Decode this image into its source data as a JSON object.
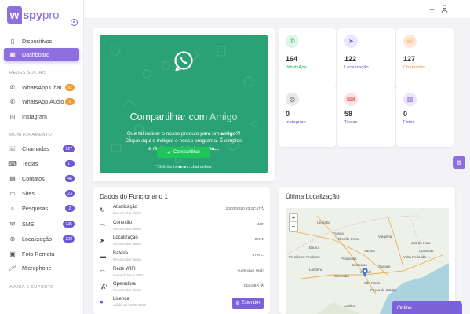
{
  "brand": {
    "mark": "w",
    "name_bold": "spy",
    "name_light": "pro"
  },
  "sidebar": {
    "top_items": [
      {
        "label": "Dispositivos",
        "icon": "phone-icon"
      },
      {
        "label": "Dashboard",
        "icon": "dashboard-icon"
      }
    ],
    "sections": {
      "social": "REDES SOCIAIS",
      "monitor": "MONITORAMENTO",
      "help": "AJUDA E SUPORTE"
    },
    "social_items": [
      {
        "label": "WhatsApp Chat",
        "icon": "whatsapp-icon",
        "badge": "92"
      },
      {
        "label": "WhatsApp Áudio",
        "icon": "whatsapp-audio-icon",
        "badge": "0"
      },
      {
        "label": "Instagram",
        "icon": "instagram-icon"
      }
    ],
    "monitor_items": [
      {
        "label": "Chamadas",
        "icon": "call-icon",
        "badge": "127"
      },
      {
        "label": "Teclas",
        "icon": "keyboard-icon",
        "badge": "17"
      },
      {
        "label": "Contatos",
        "icon": "contacts-icon",
        "badge": "46"
      },
      {
        "label": "Sites",
        "icon": "sites-icon",
        "badge": "23"
      },
      {
        "label": "Pesquisas",
        "icon": "search-icon",
        "badge": "2"
      },
      {
        "label": "SMS",
        "icon": "sms-icon",
        "badge": "245"
      },
      {
        "label": "Localização",
        "icon": "location-icon",
        "badge": "122"
      },
      {
        "label": "Foto Remota",
        "icon": "camera-icon"
      },
      {
        "label": "Microphone",
        "icon": "microphone-icon"
      }
    ]
  },
  "hero": {
    "title_plain": "Compartilhar com ",
    "title_highlight": "Amigo",
    "text_a": "Que tal indicar o nosso produto para um ",
    "text_bold1": "amigo",
    "text_b": "?! Clique aqui e indique o nosso programa. É simples e rápido e você ainda ",
    "text_bold2": "ganha...",
    "hint_a": "* Solicitar bônus no ",
    "hint_b": "chat online",
    "button": "Compartilhar"
  },
  "stats": [
    {
      "value": "164",
      "label": "WhatsApp",
      "color": "#1fba5a",
      "bg": "#dff5e8",
      "icon": "whatsapp-icon"
    },
    {
      "value": "122",
      "label": "Localização",
      "color": "#6f55d8",
      "bg": "#ebe6fb",
      "icon": "location-icon"
    },
    {
      "value": "127",
      "label": "Chamadas",
      "color": "#f0902f",
      "bg": "#fde9d6",
      "icon": "call-icon"
    },
    {
      "value": "0",
      "label": "Instagram",
      "color": "#444",
      "bg": "#e8e8e8",
      "icon": "instagram-icon"
    },
    {
      "value": "58",
      "label": "Teclas",
      "color": "#e05561",
      "bg": "#fbe2e4",
      "icon": "keyboard-icon"
    },
    {
      "value": "0",
      "label": "Fotos",
      "color": "#7b62d8",
      "bg": "#ebe6fb",
      "icon": "photo-icon"
    }
  ],
  "employee": {
    "title": "Dados do Funcionario 1",
    "rows": [
      {
        "title": "Atualização",
        "sub": "Resumo dos dados",
        "value": "10/03/2020 23:17:47 ↻",
        "icon": "refresh-icon"
      },
      {
        "title": "Conexão",
        "sub": "Resumo dos dados",
        "value": "WiFi ",
        "icon": "wifi-icon"
      },
      {
        "title": "Localização",
        "sub": "Resumo dos dados",
        "value": "ON ➤",
        "icon": "location-icon"
      },
      {
        "title": "Bateria",
        "sub": "Resumo dos dados",
        "value": "57% ▭",
        "icon": "battery-icon"
      },
      {
        "title": "Rede WIFI",
        "sub": "Nome da Rede WIFI",
        "value": "<unknown ssid> ",
        "icon": "wifi-icon"
      },
      {
        "title": "Operadora",
        "sub": "Resumo dos dados",
        "value": "Claro BR ⁽Ⱥ⁾",
        "icon": "antenna-icon"
      },
      {
        "title": "Licença",
        "sub": "Válida até: 15/06/2020",
        "value": "",
        "icon": "user-icon"
      }
    ],
    "extend_button": "Estender"
  },
  "location": {
    "title": "Última Localização",
    "marker_label": "São Paulo"
  },
  "map_places": [
    "Ribeirão Preto",
    "Sorocaba",
    "Campinas",
    "São Paulo",
    "Santos",
    "Poços de Caldas",
    "Bauru",
    "Jundiaí",
    "Taubaté",
    "Curitiba",
    "Londrina",
    "Franca",
    "Uberaba",
    "Varginha",
    "Piracicaba",
    "Volta Redonda",
    "Juiz de Fora",
    "Presidente Prudente",
    "Goytacaz"
  ],
  "chat": {
    "label": "Online"
  }
}
